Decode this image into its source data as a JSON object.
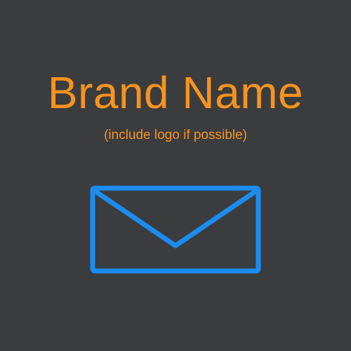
{
  "brand": {
    "title": "Brand Name",
    "subtitle": "(include logo if possible)"
  },
  "icons": {
    "envelope": "envelope-icon"
  },
  "colors": {
    "background": "#3b3c3e",
    "title": "#f7931e",
    "subtitle": "#f7931e",
    "envelope": "#1b8cf2"
  }
}
